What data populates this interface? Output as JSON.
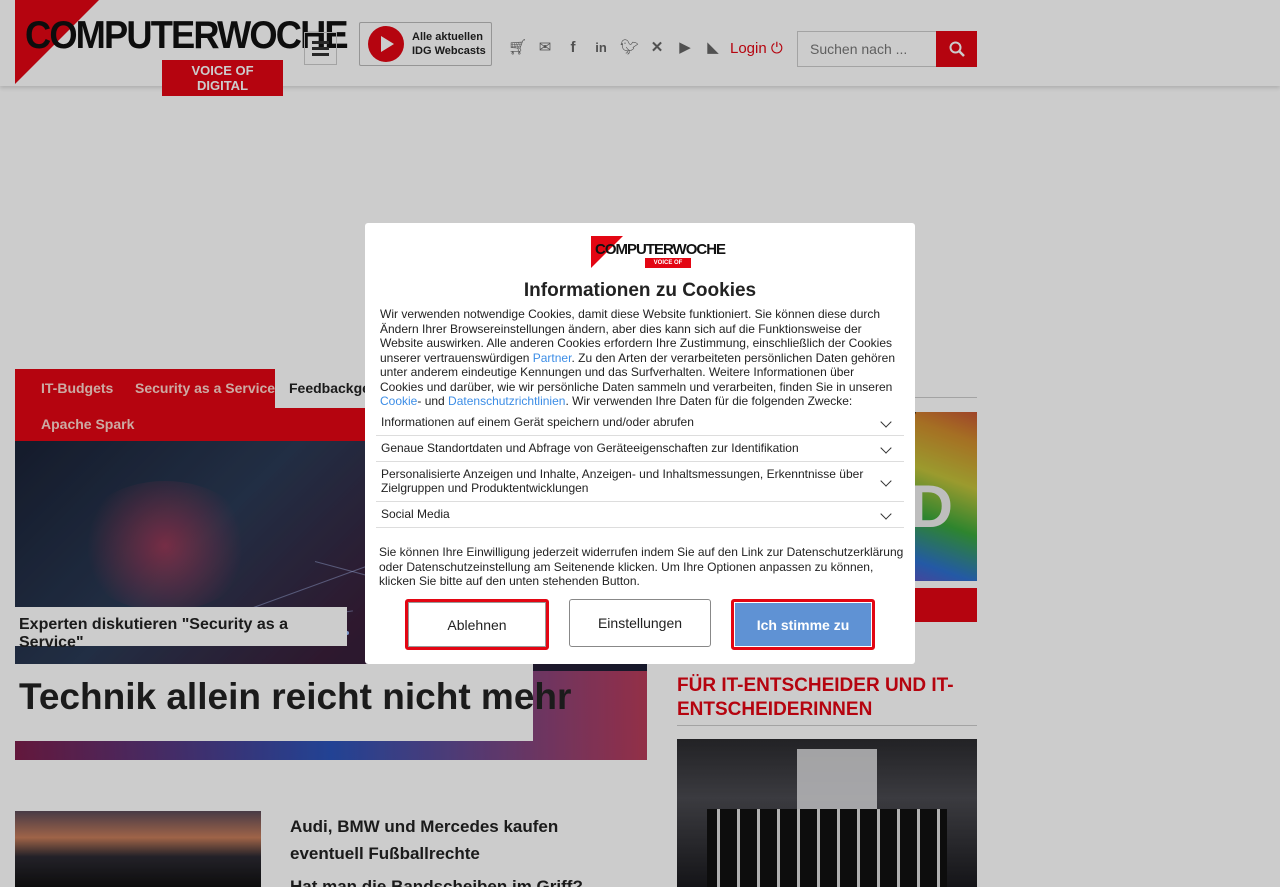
{
  "header": {
    "logo_name": "COMPUTERWOCHE",
    "logo_tagline": "VOICE OF DIGITAL",
    "webcast_line1": "Alle aktuellen",
    "webcast_line2": "IDG Webcasts",
    "social_icons": [
      "shopping-cart-icon",
      "envelope-icon",
      "facebook-icon",
      "linkedin-icon",
      "twitter-icon",
      "xing-icon",
      "youtube-icon",
      "rss-icon"
    ],
    "login_label": "Login",
    "search_placeholder": "Suchen nach ..."
  },
  "tags": {
    "items": [
      "IT-Budgets",
      "Security as a Service",
      "Feedbackges",
      "Apache Spark"
    ]
  },
  "hero": {
    "kicker": "Experten diskutieren \"Security as a Service\"",
    "headline": "Technik allein reicht nicht mehr"
  },
  "articles": [
    {
      "title": "Audi, BMW und Mercedes kaufen eventuell Fußballrechte"
    },
    {
      "title": "Hat man die Bandscheiben im Griff?"
    }
  ],
  "sidebar": {
    "section_title": "Für IT-Entscheider und IT-Entscheiderinnen"
  },
  "cookie_modal": {
    "logo_name": "COMPUTERWOCHE",
    "logo_tagline": "VOICE OF DIGITAL",
    "title": "Informationen zu Cookies",
    "text_before_partner": "Wir verwenden notwendige Cookies, damit diese Website funktioniert. Sie können diese durch Ändern Ihrer Browsereinstellungen ändern, aber dies kann sich auf die Funktionsweise der Website auswirken. Alle anderen Cookies erfordern Ihre Zustimmung, einschließlich der Cookies unserer vertrauenswürdigen ",
    "partner_link": "Partner",
    "text_after_partner": ". Zu den Arten der verarbeiteten persönlichen Daten gehören unter anderem eindeutige Kennungen und das Surfverhalten. Weitere Informationen über Cookies und darüber, wie wir persönliche Daten sammeln und verarbeiten, finden Sie in unseren ",
    "cookie_link": "Cookie",
    "text_und": "- und ",
    "privacy_link": "Datenschutzrichtlinien",
    "text_end": ". Wir verwenden Ihre Daten für die folgenden Zwecke:",
    "purposes": [
      "Informationen auf einem Gerät speichern und/oder abrufen",
      "Genaue Standortdaten und Abfrage von Geräteeigenschaften zur Identifikation",
      "Personalisierte Anzeigen und Inhalte, Anzeigen- und Inhaltsmessungen, Erkenntnisse über Zielgruppen und Produktentwicklungen",
      "Social Media"
    ],
    "footer_text": "Sie können Ihre Einwilligung jederzeit widerrufen indem Sie auf den Link zur Datenschutzerklärung oder Datenschutzeinstellung am Seitenende klicken. Um Ihre Optionen anpassen zu können, klicken Sie bitte auf den unten stehenden Button.",
    "decline_label": "Ablehnen",
    "settings_label": "Einstellungen",
    "accept_label": "Ich stimme zu"
  }
}
